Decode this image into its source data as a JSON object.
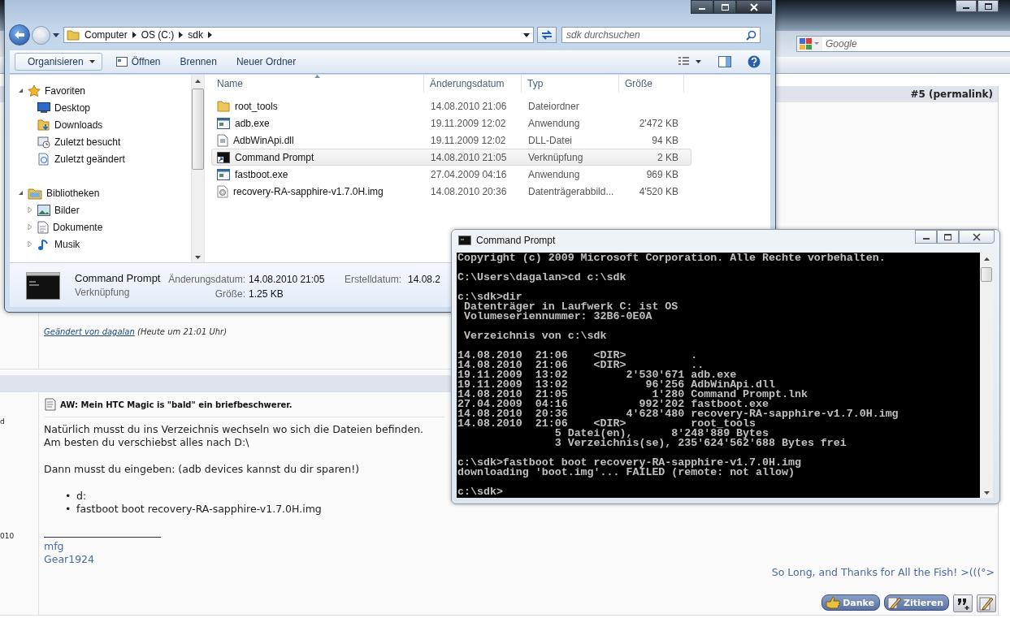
{
  "browser": {
    "search": {
      "placeholder": "Google"
    }
  },
  "posts": [
    {
      "number": "#5 (permalink)",
      "edit_note": {
        "link": "Geändert von dagalan",
        "time": "(Heute um 21:01 Uhr)"
      }
    },
    {
      "side_fragments": [
        "d",
        "010"
      ],
      "title": "AW: Mein HTC Magic is \"bald\" ein briefbeschwerer.",
      "paragraphs": [
        [
          "Natürlich musst du ins Verzeichnis wechseln wo sich die Dateien befinden.",
          "Am besten du verschiebst alles nach D:\\"
        ],
        [
          "Dann musst du eingeben: (adb devices kannst du dir sparen!)"
        ]
      ],
      "list": [
        {
          "marker": "•",
          "text": "d:"
        },
        {
          "marker": "•",
          "text": "fastboot boot recovery-RA-sapphire-v1.7.0H.img"
        }
      ],
      "signature": [
        "mfg",
        "Gear1924"
      ],
      "motto": "So Long, and Thanks for All the Fish! >(((°>",
      "buttons": [
        {
          "kind": "thanks",
          "label": "Danke"
        },
        {
          "kind": "quote",
          "label": "Zitieren"
        },
        {
          "kind": "multiquote"
        },
        {
          "kind": "edit"
        }
      ]
    }
  ],
  "explorer": {
    "address": {
      "crumbs": [
        "Computer",
        "OS (C:)",
        "sdk"
      ]
    },
    "search": {
      "placeholder": "sdk durchsuchen"
    },
    "toolbar": [
      {
        "kind": "menu",
        "label": "Organisieren"
      },
      {
        "kind": "open",
        "label": "Öffnen"
      },
      {
        "kind": "plain",
        "label": "Brennen"
      },
      {
        "kind": "plain",
        "label": "Neuer Ordner"
      }
    ],
    "nav": [
      {
        "label": "Favoriten",
        "kind": "favorites",
        "expanded": true,
        "children": [
          {
            "label": "Desktop",
            "kind": "desktop"
          },
          {
            "label": "Downloads",
            "kind": "downloads"
          },
          {
            "label": "Zuletzt besucht",
            "kind": "recent"
          },
          {
            "label": "Zuletzt geändert",
            "kind": "changed"
          }
        ]
      },
      {
        "label": "Bibliotheken",
        "kind": "libraries",
        "expanded": true,
        "children": [
          {
            "label": "Bilder",
            "kind": "pictures",
            "expanded": false
          },
          {
            "label": "Dokumente",
            "kind": "documents",
            "expanded": false
          },
          {
            "label": "Musik",
            "kind": "music",
            "expanded": false
          }
        ]
      }
    ],
    "columns": [
      "Name",
      "Änderungsdatum",
      "Typ",
      "Größe"
    ],
    "files": [
      {
        "name": "root_tools",
        "date": "14.08.2010 21:06",
        "type": "Dateiordner",
        "kind": "folder",
        "selected": false
      },
      {
        "name": "adb.exe",
        "date": "19.11.2009 12:02",
        "type": "Anwendung",
        "size": "2'472 KB",
        "kind": "exe",
        "selected": false
      },
      {
        "name": "AdbWinApi.dll",
        "date": "19.11.2009 12:02",
        "type": "DLL-Datei",
        "size": "94 KB",
        "kind": "dll",
        "selected": false
      },
      {
        "name": "Command Prompt",
        "date": "14.08.2010 21:05",
        "type": "Verknüpfung",
        "size": "2 KB",
        "kind": "shortcut",
        "selected": true
      },
      {
        "name": "fastboot.exe",
        "date": "27.04.2009 04:16",
        "type": "Anwendung",
        "size": "969 KB",
        "kind": "exe",
        "selected": false
      },
      {
        "name": "recovery-RA-sapphire-v1.7.0H.img",
        "date": "14.08.2010 20:36",
        "type": "Datenträgerabbild...",
        "size": "4'520 KB",
        "kind": "image",
        "selected": false
      }
    ],
    "details": {
      "name": "Command Prompt",
      "type": "Verknüpfung",
      "fields": [
        {
          "label": "Änderungsdatum:",
          "value": "14.08.2010 21:05"
        },
        {
          "label": "Größe:",
          "value": "1.25 KB"
        },
        {
          "label": "Erstelldatum:",
          "value": "14.08.2"
        }
      ]
    }
  },
  "console": {
    "title": "Command Prompt",
    "blocks": [
      [
        "Copyright (c) 2009 Microsoft Corporation. Alle Rechte vorbehalten."
      ],
      [
        "C:\\Users\\dagalan>cd c:\\sdk"
      ],
      [
        "c:\\sdk>dir",
        " Datenträger in Laufwerk C: ist OS",
        " Volumeseriennummer: 32B6-0E0A"
      ],
      [
        " Verzeichnis von c:\\sdk"
      ],
      [
        "14.08.2010  21:06    <DIR>          .",
        "14.08.2010  21:06    <DIR>          ..",
        "19.11.2009  13:02         2'530'671 adb.exe",
        "19.11.2009  13:02            96'256 AdbWinApi.dll",
        "14.08.2010  21:05             1'280 Command Prompt.lnk",
        "27.04.2009  04:16           992'202 fastboot.exe",
        "14.08.2010  20:36         4'628'480 recovery-RA-sapphire-v1.7.0H.img",
        "14.08.2010  21:06    <DIR>          root_tools",
        "               5 Datei(en),      8'248'889 Bytes",
        "               3 Verzeichnis(se), 235'624'562'688 Bytes frei"
      ],
      [
        "c:\\sdk>fastboot boot recovery-RA-sapphire-v1.7.0H.img",
        "downloading 'boot.img'... FAILED (remote: not allow)"
      ],
      [
        "c:\\sdk>"
      ]
    ]
  }
}
